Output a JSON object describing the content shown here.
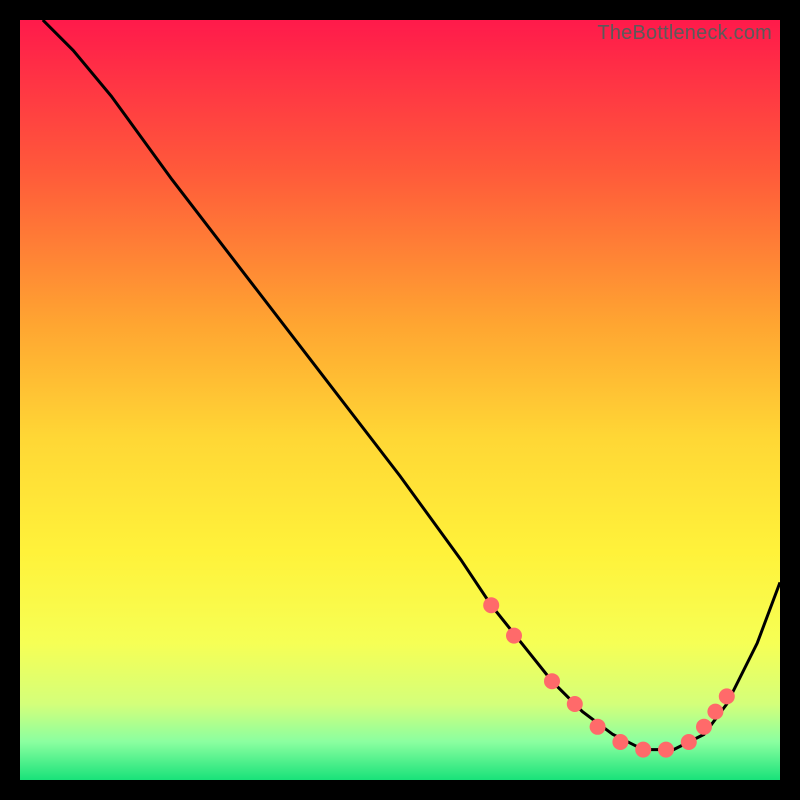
{
  "watermark": "TheBottleneck.com",
  "chart_data": {
    "type": "line",
    "title": "",
    "xlabel": "",
    "ylabel": "",
    "xlim": [
      0,
      100
    ],
    "ylim": [
      0,
      100
    ],
    "grid": false,
    "legend": false,
    "background_gradient": {
      "stops": [
        {
          "offset": 0.0,
          "color": "#ff1a4b"
        },
        {
          "offset": 0.2,
          "color": "#ff5a3a"
        },
        {
          "offset": 0.4,
          "color": "#ffa531"
        },
        {
          "offset": 0.55,
          "color": "#ffd735"
        },
        {
          "offset": 0.7,
          "color": "#fff23a"
        },
        {
          "offset": 0.82,
          "color": "#f6ff55"
        },
        {
          "offset": 0.9,
          "color": "#d4ff7a"
        },
        {
          "offset": 0.95,
          "color": "#8affa0"
        },
        {
          "offset": 1.0,
          "color": "#18e27a"
        }
      ]
    },
    "series": [
      {
        "name": "bottleneck-curve",
        "color": "#000000",
        "x": [
          3,
          7,
          12,
          20,
          30,
          40,
          50,
          58,
          62,
          66,
          70,
          74,
          78,
          82,
          86,
          90,
          93,
          97,
          100
        ],
        "y": [
          100,
          96,
          90,
          79,
          66,
          53,
          40,
          29,
          23,
          18,
          13,
          9,
          6,
          4,
          4,
          6,
          10,
          18,
          26
        ]
      }
    ],
    "markers": {
      "name": "highlight-dots",
      "color": "#ff6a6a",
      "radius": 8,
      "points": [
        {
          "x": 62,
          "y": 23
        },
        {
          "x": 65,
          "y": 19
        },
        {
          "x": 70,
          "y": 13
        },
        {
          "x": 73,
          "y": 10
        },
        {
          "x": 76,
          "y": 7
        },
        {
          "x": 79,
          "y": 5
        },
        {
          "x": 82,
          "y": 4
        },
        {
          "x": 85,
          "y": 4
        },
        {
          "x": 88,
          "y": 5
        },
        {
          "x": 90,
          "y": 7
        },
        {
          "x": 91.5,
          "y": 9
        },
        {
          "x": 93,
          "y": 11
        }
      ]
    }
  }
}
